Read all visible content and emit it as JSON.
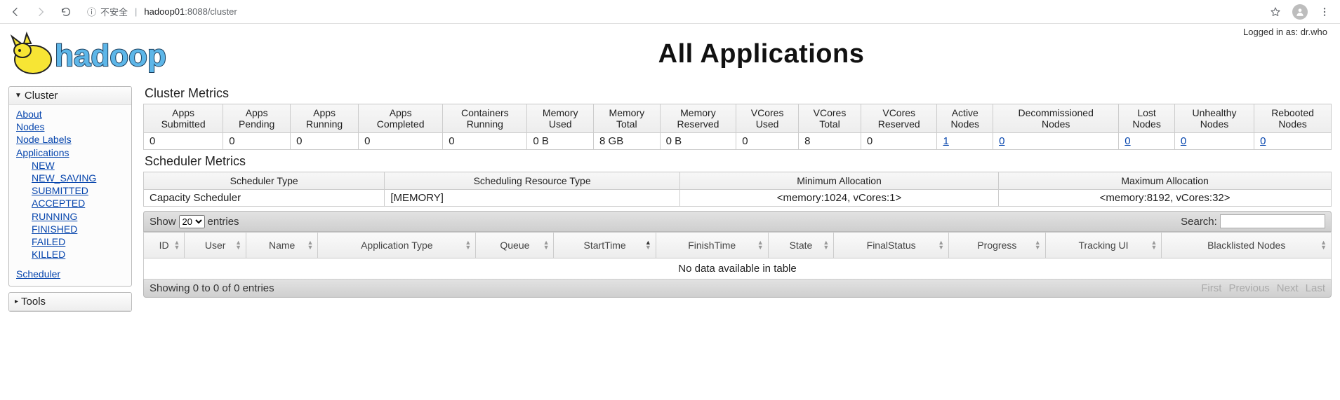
{
  "browser": {
    "insecure_label": "不安全",
    "host": "hadoop01",
    "port": ":8088",
    "path": "/cluster"
  },
  "logged_in_prefix": "Logged in as: ",
  "logged_in_user": "dr.who",
  "page_title": "All Applications",
  "sidebar": {
    "cluster_label": "Cluster",
    "tools_label": "Tools",
    "links": {
      "about": "About",
      "nodes": "Nodes",
      "node_labels": "Node Labels",
      "applications": "Applications",
      "scheduler": "Scheduler"
    },
    "app_states": [
      "NEW",
      "NEW_SAVING",
      "SUBMITTED",
      "ACCEPTED",
      "RUNNING",
      "FINISHED",
      "FAILED",
      "KILLED"
    ]
  },
  "cluster_metrics": {
    "title": "Cluster Metrics",
    "headers": [
      "Apps Submitted",
      "Apps Pending",
      "Apps Running",
      "Apps Completed",
      "Containers Running",
      "Memory Used",
      "Memory Total",
      "Memory Reserved",
      "VCores Used",
      "VCores Total",
      "VCores Reserved",
      "Active Nodes",
      "Decommissioned Nodes",
      "Lost Nodes",
      "Unhealthy Nodes",
      "Rebooted Nodes"
    ],
    "row": [
      "0",
      "0",
      "0",
      "0",
      "0",
      "0 B",
      "8 GB",
      "0 B",
      "0",
      "8",
      "0",
      "1",
      "0",
      "0",
      "0",
      "0"
    ],
    "linked_cols": [
      11,
      12,
      13,
      14,
      15
    ]
  },
  "scheduler_metrics": {
    "title": "Scheduler Metrics",
    "headers": [
      "Scheduler Type",
      "Scheduling Resource Type",
      "Minimum Allocation",
      "Maximum Allocation"
    ],
    "row": [
      "Capacity Scheduler",
      "[MEMORY]",
      "<memory:1024, vCores:1>",
      "<memory:8192, vCores:32>"
    ]
  },
  "datatable": {
    "show_prefix": "Show",
    "show_value": "20",
    "show_suffix": "entries",
    "search_label": "Search:",
    "headers": [
      "ID",
      "User",
      "Name",
      "Application Type",
      "Queue",
      "StartTime",
      "FinishTime",
      "State",
      "FinalStatus",
      "Progress",
      "Tracking UI",
      "Blacklisted Nodes"
    ],
    "sorted_col": 5,
    "sorted_dir": "asc",
    "no_data": "No data available in table",
    "footer_info": "Showing 0 to 0 of 0 entries",
    "pager": [
      "First",
      "Previous",
      "Next",
      "Last"
    ]
  }
}
